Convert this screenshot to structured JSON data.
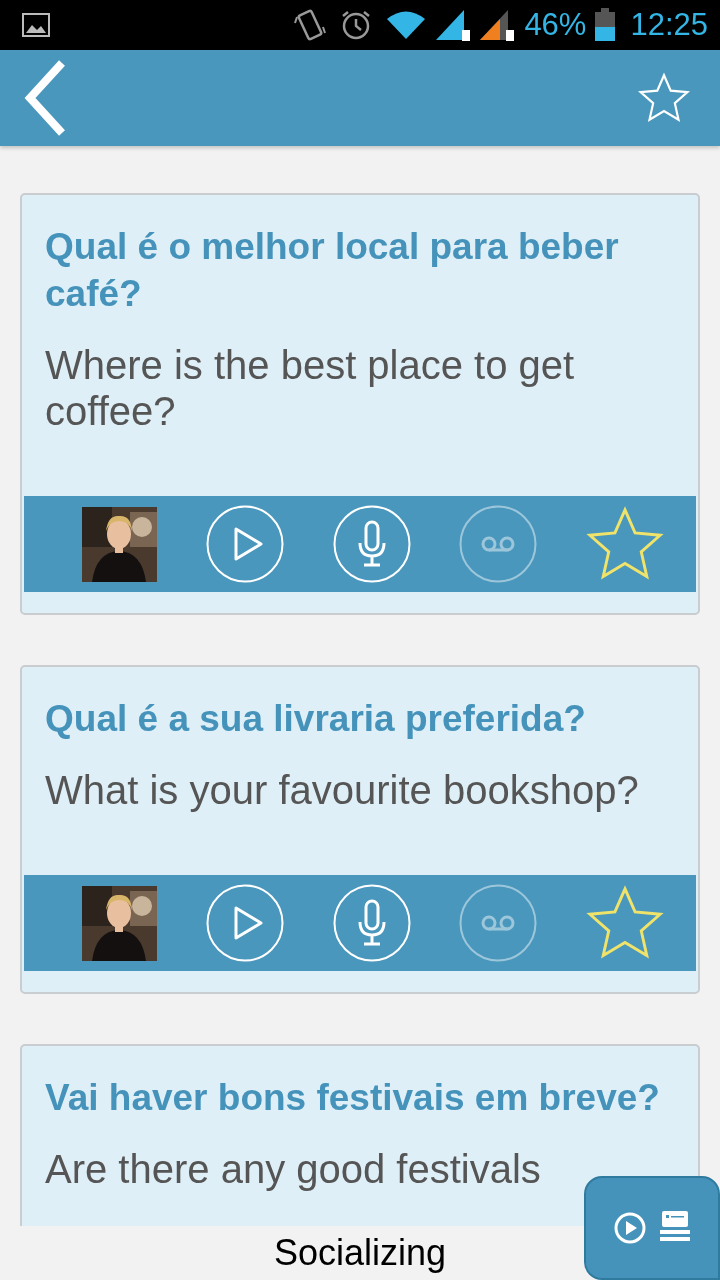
{
  "status_bar": {
    "battery_text": "46%",
    "time": "12:25"
  },
  "header": {
    "favorite": false
  },
  "phrases": [
    {
      "title": "Qual é o melhor local para beber café?",
      "translation": "Where is the best place to get coffee?",
      "favorite": false,
      "recording_available": false
    },
    {
      "title": "Qual é a sua livraria preferida?",
      "translation": "What is your favourite bookshop?",
      "favorite": false,
      "recording_available": false
    },
    {
      "title": "Vai haver bons festivais em breve?",
      "translation": "Are there any good festivals"
    }
  ],
  "footer": {
    "category": "Socializing"
  }
}
